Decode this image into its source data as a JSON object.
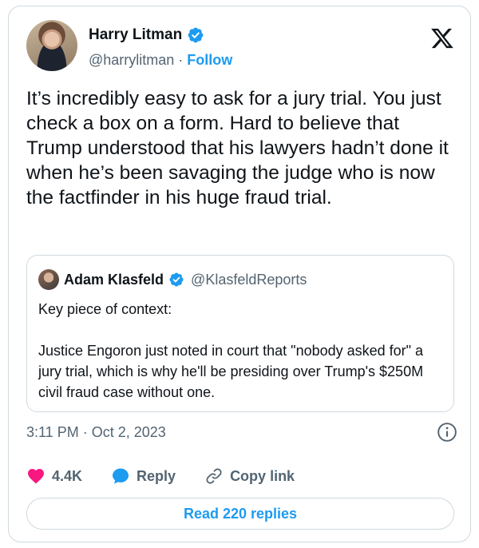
{
  "author": {
    "name": "Harry Litman",
    "handle": "@harrylitman",
    "separator": " · ",
    "follow_label": "Follow"
  },
  "tweet": {
    "text": "It’s incredibly easy to ask for a jury trial. You just check a box on a form. Hard to believe that Trump understood that his lawyers hadn’t done it when he’s been savaging the judge who is now the factfinder in his huge fraud trial.",
    "timestamp": "3:11 PM · Oct 2, 2023"
  },
  "quote": {
    "name": "Adam Klasfeld",
    "handle": "@KlasfeldReports",
    "line1": "Key piece of context:",
    "line2": "Justice Engoron just noted in court that \"nobody asked for\" a jury trial, which is why he'll be presiding over Trump's $250M civil fraud case without one."
  },
  "actions": {
    "likes": "4.4K",
    "reply_label": "Reply",
    "copy_label": "Copy link"
  },
  "read_replies_label": "Read 220 replies",
  "colors": {
    "accent": "#1d9bf0",
    "like": "#f91880",
    "muted": "#536471",
    "border": "#cfd9de"
  },
  "icons": [
    "verified-badge-icon",
    "x-logo-icon",
    "info-icon",
    "heart-icon",
    "reply-bubble-icon",
    "link-icon"
  ]
}
